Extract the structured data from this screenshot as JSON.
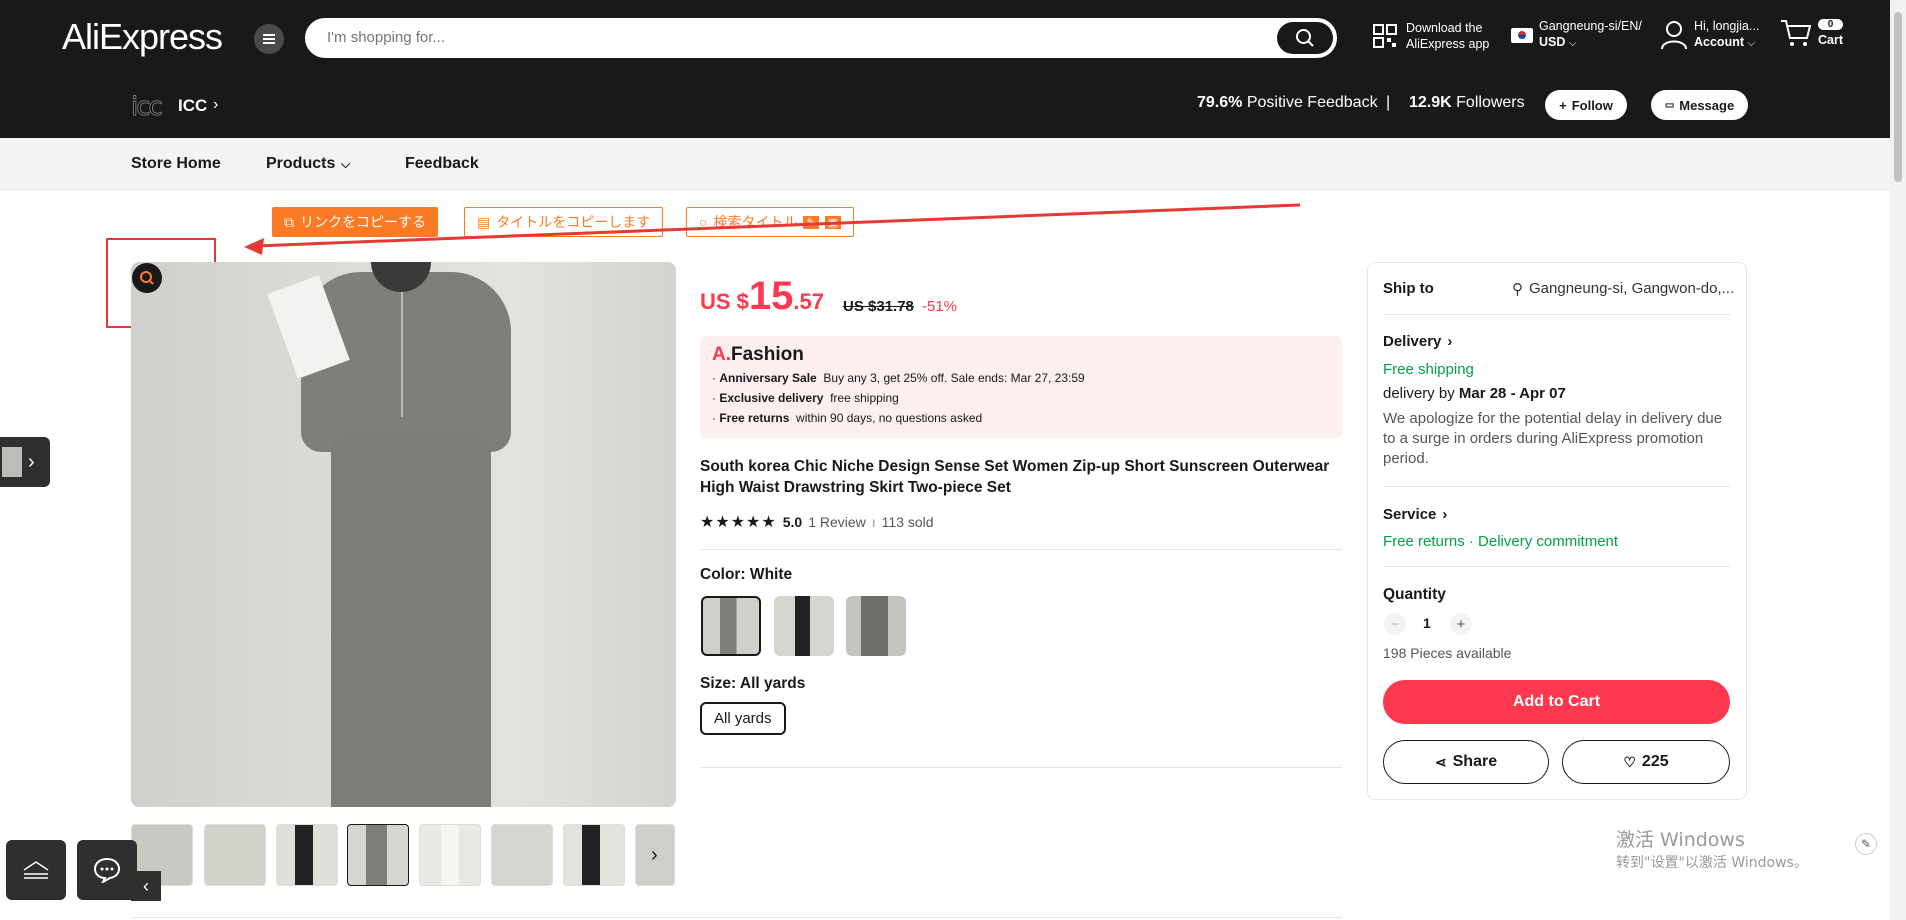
{
  "header": {
    "logo": "AliExpress",
    "search_placeholder": "I'm shopping for...",
    "download_line1": "Download the",
    "download_line2": "AliExpress app",
    "region_line1": "Gangneung-si/EN/",
    "region_line2": "USD",
    "account_line1": "Hi, longjia...",
    "account_line2": "Account",
    "cart_count": "0",
    "cart_label": "Cart"
  },
  "store": {
    "logo_text": "icc",
    "name": "ICC",
    "feedback_value": "79.6%",
    "feedback_label": "Positive Feedback",
    "separator": "|",
    "followers_value": "12.9K",
    "followers_label": "Followers",
    "follow_label": "Follow",
    "message_label": "Message"
  },
  "nav": {
    "home": "Store Home",
    "products": "Products",
    "feedback": "Feedback"
  },
  "tools": {
    "copy_link": "リンクをコピーする",
    "copy_title": "タイトルをコピーします",
    "search_title": "検索タイトル"
  },
  "product": {
    "price_prefix": "US $",
    "price_int": "15",
    "price_dec": ".57",
    "original_price": "US $31.78",
    "discount": "-51%",
    "promo_brand_a": "A.",
    "promo_brand": "Fashion",
    "promo_items": [
      {
        "bold": "Anniversary Sale",
        "text": "Buy any 3, get 25% off. Sale ends: Mar 27, 23:59"
      },
      {
        "bold": "Exclusive delivery",
        "text": "free shipping"
      },
      {
        "bold": "Free returns",
        "text": "within 90 days, no questions asked"
      }
    ],
    "title": "South korea Chic Niche Design Sense Set Women Zip-up Short Sunscreen Outerwear High Waist Drawstring Skirt Two-piece Set",
    "stars": "★★★★★",
    "rating": "5.0",
    "reviews": "1 Review",
    "sold": "113 sold",
    "color_label": "Color: White",
    "size_label": "Size: All yards",
    "size_option": "All yards"
  },
  "side_panel": {
    "ship_to_label": "Ship to",
    "ship_to_value": "Gangneung-si, Gangwon-do,...",
    "delivery_label": "Delivery",
    "free_shipping": "Free shipping",
    "delivery_by_prefix": "delivery by ",
    "delivery_by_dates": "Mar 28 - Apr 07",
    "delay_note": "We apologize for the potential delay in delivery due to a surge in orders during AliExpress promotion period.",
    "service_label": "Service",
    "service_returns": "Free returns",
    "service_dot": "·",
    "service_commitment": "Delivery commitment",
    "quantity_label": "Quantity",
    "quantity_value": "1",
    "pieces_available": "198 Pieces available",
    "add_to_cart": "Add to Cart",
    "share": "Share",
    "wishlist_count": "225"
  },
  "watermark": {
    "line1": "激活 Windows",
    "line2": "转到\"设置\"以激活 Windows。"
  },
  "colors": {
    "accent_red": "#fd384f",
    "header_bg": "#191919",
    "tool_orange": "#fd7a24",
    "green": "#00a04a"
  }
}
